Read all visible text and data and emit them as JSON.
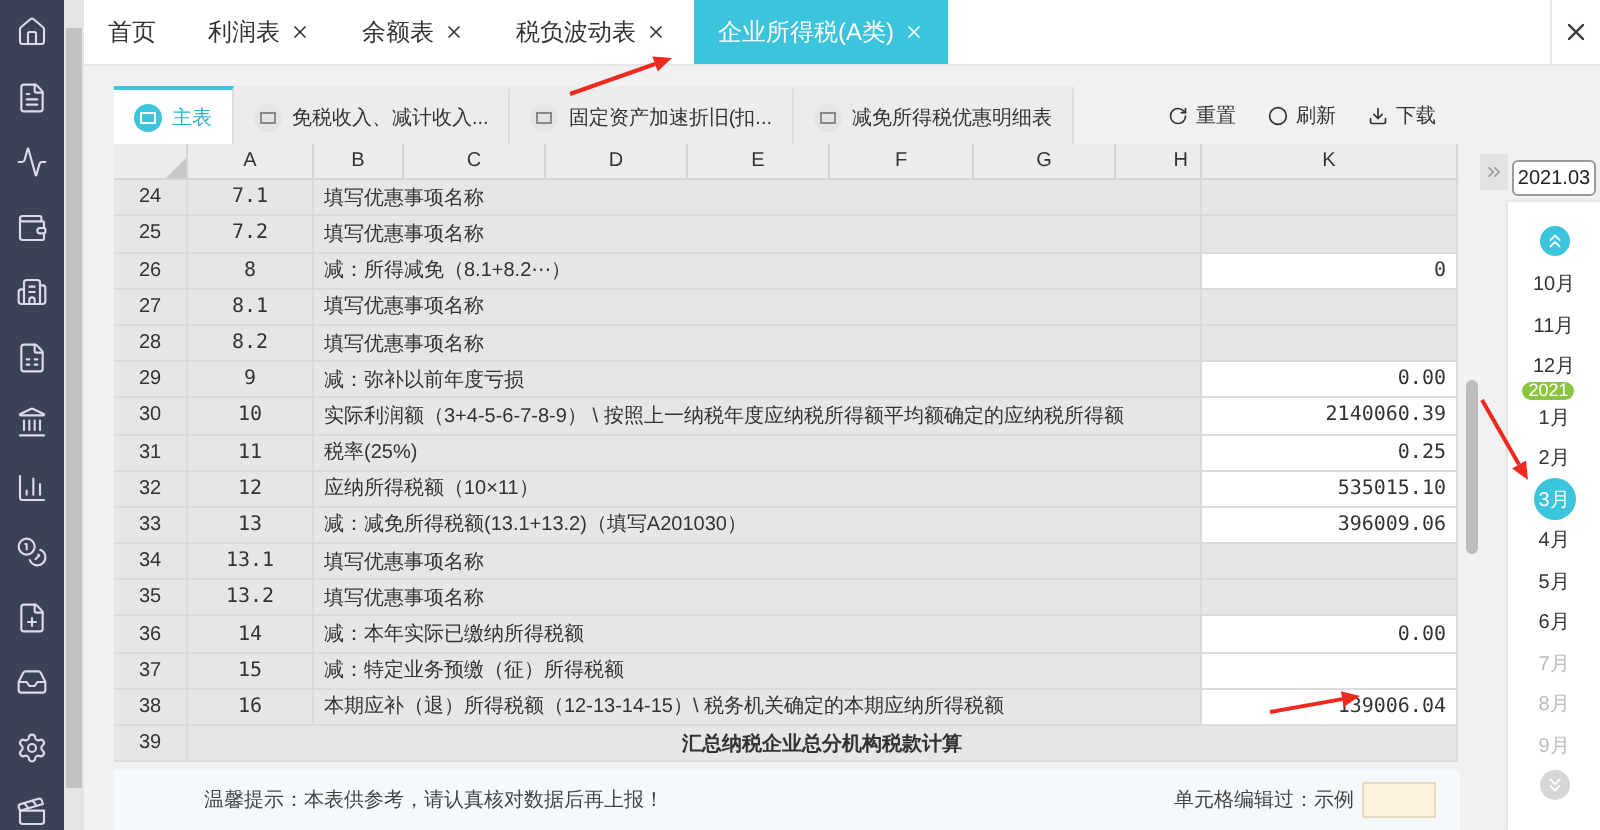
{
  "tabs": [
    {
      "label": "首页",
      "closable": false,
      "selected": false
    },
    {
      "label": "利润表",
      "closable": true,
      "selected": false
    },
    {
      "label": "余额表",
      "closable": true,
      "selected": false
    },
    {
      "label": "税负波动表",
      "closable": true,
      "selected": false
    },
    {
      "label": "企业所得税(A类)",
      "closable": true,
      "selected": true
    }
  ],
  "sheet_tabs": [
    {
      "label": "主表",
      "selected": true
    },
    {
      "label": "免税收入、减计收入...",
      "selected": false
    },
    {
      "label": "固定资产加速折旧(扣...",
      "selected": false
    },
    {
      "label": "减免所得税优惠明细表",
      "selected": false
    }
  ],
  "actions": [
    {
      "kind": "reset",
      "label": "重置"
    },
    {
      "kind": "refresh",
      "label": "刷新"
    },
    {
      "kind": "download",
      "label": "下载"
    }
  ],
  "columns": [
    "A",
    "B",
    "C",
    "D",
    "E",
    "F",
    "G",
    "H",
    "K"
  ],
  "rows": [
    {
      "kind": "item",
      "row": "24",
      "line": "7.1",
      "item": "填写优惠事项名称",
      "value": "",
      "editable": false
    },
    {
      "kind": "item",
      "row": "25",
      "line": "7.2",
      "item": "填写优惠事项名称",
      "value": "",
      "editable": false
    },
    {
      "kind": "item",
      "row": "26",
      "line": "8",
      "item": "减：所得减免（8.1+8.2⋯）",
      "value": "0",
      "editable": true
    },
    {
      "kind": "item",
      "row": "27",
      "line": "8.1",
      "item": "填写优惠事项名称",
      "value": "",
      "editable": false
    },
    {
      "kind": "item",
      "row": "28",
      "line": "8.2",
      "item": "填写优惠事项名称",
      "value": "",
      "editable": false
    },
    {
      "kind": "item",
      "row": "29",
      "line": "9",
      "item": "减：弥补以前年度亏损",
      "value": "0.00",
      "editable": true
    },
    {
      "kind": "item",
      "row": "30",
      "line": "10",
      "item": "实际利润额（3+4-5-6-7-8-9） \\ 按照上一纳税年度应纳税所得额平均额确定的应纳税所得额",
      "value": "2140060.39",
      "editable": true
    },
    {
      "kind": "item",
      "row": "31",
      "line": "11",
      "item": "税率(25%)",
      "value": "0.25",
      "editable": true
    },
    {
      "kind": "item",
      "row": "32",
      "line": "12",
      "item": "应纳所得税额（10×11）",
      "value": "535015.10",
      "editable": true
    },
    {
      "kind": "item",
      "row": "33",
      "line": "13",
      "item": "减：减免所得税额(13.1+13.2)（填写A201030）",
      "value": "396009.06",
      "editable": true
    },
    {
      "kind": "item",
      "row": "34",
      "line": "13.1",
      "item": "填写优惠事项名称",
      "value": "",
      "editable": false
    },
    {
      "kind": "item",
      "row": "35",
      "line": "13.2",
      "item": "填写优惠事项名称",
      "value": "",
      "editable": false
    },
    {
      "kind": "item",
      "row": "36",
      "line": "14",
      "item": "减：本年实际已缴纳所得税额",
      "value": "0.00",
      "editable": true
    },
    {
      "kind": "item",
      "row": "37",
      "line": "15",
      "item": "减：特定业务预缴（征）所得税额",
      "value": "",
      "editable": true
    },
    {
      "kind": "item",
      "row": "38",
      "line": "16",
      "item": "本期应补（退）所得税额（12-13-14-15）\\ 税务机关确定的本期应纳所得税额",
      "value": "139006.04",
      "editable": true
    },
    {
      "kind": "section",
      "row": "39",
      "item": "汇总纳税企业总分机构税款计算"
    }
  ],
  "footer": {
    "tip": "温馨提示：本表供参考，请认真核对数据后再上报！",
    "legend": "单元格编辑过：示例"
  },
  "period": {
    "value": "2021.03"
  },
  "months": [
    {
      "label": "10月",
      "selected": false,
      "disabled": false
    },
    {
      "label": "11月",
      "selected": false,
      "disabled": false
    },
    {
      "label": "12月",
      "selected": false,
      "disabled": false
    },
    {
      "label": "1月",
      "selected": false,
      "disabled": false,
      "year_badge": "2021"
    },
    {
      "label": "2月",
      "selected": false,
      "disabled": false
    },
    {
      "label": "3月",
      "selected": true,
      "disabled": false
    },
    {
      "label": "4月",
      "selected": false,
      "disabled": false
    },
    {
      "label": "5月",
      "selected": false,
      "disabled": false
    },
    {
      "label": "6月",
      "selected": false,
      "disabled": false
    },
    {
      "label": "7月",
      "selected": false,
      "disabled": true
    },
    {
      "label": "8月",
      "selected": false,
      "disabled": true
    },
    {
      "label": "9月",
      "selected": false,
      "disabled": true
    }
  ]
}
